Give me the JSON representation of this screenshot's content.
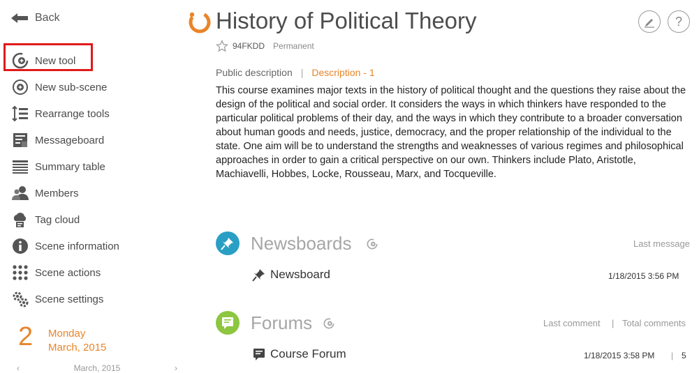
{
  "sidebar": {
    "back_label": "Back",
    "items": [
      {
        "label": "New tool",
        "icon": "new-tool-icon"
      },
      {
        "label": "New sub-scene",
        "icon": "new-sub-scene-icon"
      },
      {
        "label": "Rearrange tools",
        "icon": "rearrange-icon"
      },
      {
        "label": "Messageboard",
        "icon": "messageboard-icon"
      },
      {
        "label": "Summary table",
        "icon": "summary-table-icon"
      },
      {
        "label": "Members",
        "icon": "members-icon"
      },
      {
        "label": "Tag cloud",
        "icon": "tag-cloud-icon"
      },
      {
        "label": "Scene information",
        "icon": "info-icon"
      },
      {
        "label": "Scene actions",
        "icon": "scene-actions-icon"
      },
      {
        "label": "Scene settings",
        "icon": "gear-icon"
      }
    ],
    "date": {
      "day_number": "2",
      "weekday": "Monday",
      "month_year": "March, 2015"
    },
    "mini_calendar": {
      "prev": "‹",
      "label": "March, 2015",
      "next": "›"
    }
  },
  "header": {
    "title": "History of Political Theory",
    "code": "94FKDD",
    "status": "Permanent"
  },
  "description": {
    "tab_public": "Public description",
    "separator": "|",
    "tab_description": "Description - 1",
    "text": "This course examines major texts in the history of political thought and the questions they raise about the design of the political and social order. It considers the ways in which thinkers have responded to the particular political problems of their day, and the ways in which they contribute to a broader conversation about human goods and needs, justice, democracy, and the proper relationship of the individual to the state. One aim will be to understand the strengths and weaknesses of various regimes and philosophical approaches in order to gain a critical perspective on our own. Thinkers include Plato, Aristotle, Machiavelli, Hobbes, Locke, Rousseau, Marx, and Tocqueville."
  },
  "newsboards": {
    "title": "Newsboards",
    "col_last": "Last message",
    "rows": [
      {
        "name": "Newsboard",
        "date": "1/18/2015 3:56 PM"
      }
    ]
  },
  "forums": {
    "title": "Forums",
    "col_last": "Last comment",
    "col_sep": "|",
    "col_total": "Total comments",
    "rows": [
      {
        "name": "Course Forum",
        "date": "1/18/2015 3:58 PM",
        "sep": "|",
        "total": "5"
      }
    ]
  },
  "colors": {
    "accent": "#e8852a",
    "newsboard": "#2a9fc4",
    "forums": "#8dc63f",
    "highlight": "#e01a1a"
  }
}
